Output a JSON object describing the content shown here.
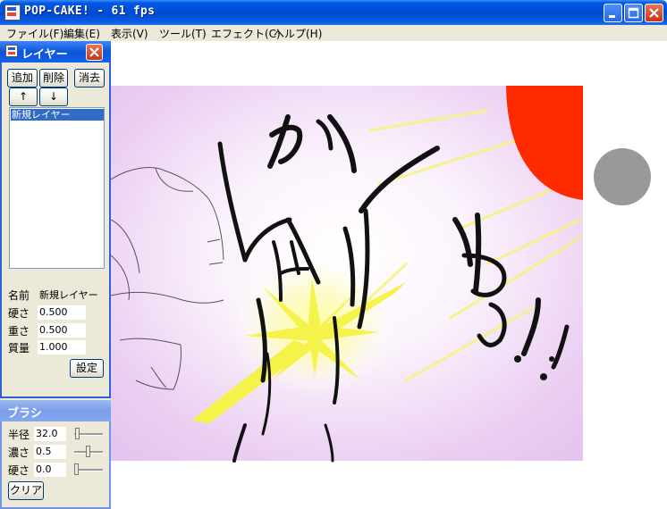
{
  "window": {
    "title": "POP-CAKE! - 61 fps"
  },
  "menu": [
    "ファイル(F)",
    "編集(E)",
    "表示(V)",
    "ツール(T)",
    "エフェクト(C)",
    "ヘルプ(H)"
  ],
  "layer_panel": {
    "title": "レイヤー",
    "buttons": {
      "add": "追加",
      "delete": "削除",
      "clear": "消去",
      "up": "↑",
      "down": "↓"
    },
    "layers": [
      "新規レイヤー"
    ],
    "props": [
      {
        "label": "名前",
        "value": "新規レイヤー"
      },
      {
        "label": "硬さ",
        "value": "0.500"
      },
      {
        "label": "重さ",
        "value": "0.500"
      },
      {
        "label": "質量",
        "value": "1.000"
      }
    ],
    "settings_button": "設定"
  },
  "brush_panel": {
    "title": "ブラシ",
    "props": [
      {
        "label": "半径",
        "value": "32.0"
      },
      {
        "label": "濃さ",
        "value": "0.5"
      },
      {
        "label": "硬さ",
        "value": "0.0"
      }
    ],
    "clear_button": "クリア"
  },
  "colors": {
    "title_blue": "#0054E3",
    "selection": "#316AC5",
    "sun_red": "#FF2A00",
    "flash_yellow": "#F5F24A",
    "bg_pink": "#E8C8F0",
    "brush_cursor": "#999999"
  },
  "icons": {
    "app": "pop-cake-app-icon",
    "minimize": "minimize-icon",
    "maximize": "maximize-icon",
    "close": "close-icon"
  }
}
